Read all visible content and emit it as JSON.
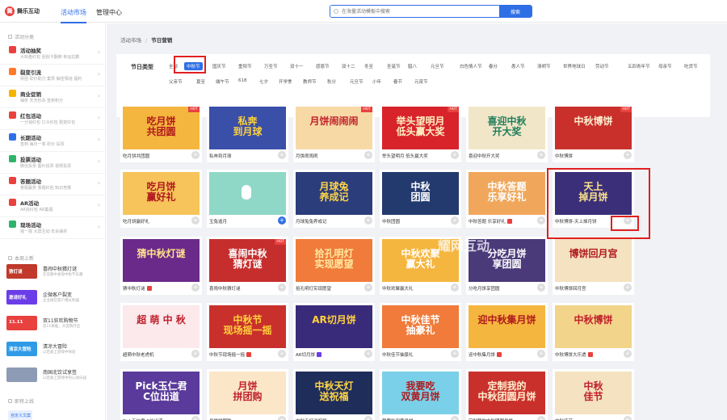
{
  "header": {
    "logo_text": "舞乐互动",
    "tabs": [
      {
        "label": "活动市场"
      },
      {
        "label": "管理中心"
      }
    ],
    "search_placeholder": "在海量活动模板中搜索",
    "search_button": "搜索"
  },
  "sidebar": {
    "section1_title": "活动分类",
    "categories": [
      {
        "title": "活动抽奖",
        "sub": "大转盘红包  刮刮卡翻牌  幸运拉霸",
        "color": "#e8413e"
      },
      {
        "title": "裂变引流",
        "sub": "拼团  砍价助力  集赞  解密猜谜  福利",
        "color": "#ff7a2b"
      },
      {
        "title": "商业促销",
        "sub": "抽奖  天天秒杀  签到积分",
        "color": "#f4b400"
      },
      {
        "title": "红包活动",
        "sub": "一分钱红包  口令红包  裂变红包",
        "color": "#e8413e"
      },
      {
        "title": "长期活动",
        "sub": "签到  每日一答  砍价  投票",
        "color": "#2f6fe6"
      },
      {
        "title": "投票活动",
        "sub": "微信投票  图片投票  视频投票",
        "color": "#2fb36a"
      },
      {
        "title": "答题活动",
        "sub": "答题赢奖  答题红包  知识竞赛",
        "color": "#e8413e"
      },
      {
        "title": "AR活动",
        "sub": "AR找红包  AR集福",
        "color": "#e8413e"
      },
      {
        "title": "现场活动",
        "sub": "摇一摇  大屏互动  年会抽奖",
        "color": "#2fb36a"
      }
    ],
    "section2_title": "本周上新",
    "news": [
      {
        "title": "喜闹中秋猜灯谜",
        "sub": "在答题中发现中秋节乐趣",
        "thumb": "猜灯谜",
        "color": "#c0392b"
      },
      {
        "title": "企微客户裂变",
        "sub": "企业微信客户增长利器",
        "thumb": "邀请好礼",
        "color": "#6a3de8"
      },
      {
        "title": "双11狂欢购物节",
        "sub": "双11来临，大促销开启",
        "thumb": "11.11",
        "color": "#e8413e"
      },
      {
        "title": "清凉大冒险",
        "sub": "以后爱上游戏中体验",
        "thumb": "清凉大冒险",
        "color": "#2f9be6"
      },
      {
        "title": "南国北饮试享签",
        "sub": "以后爱上游戏中的心动乐园",
        "thumb": "",
        "color": "#8e9bb5"
      }
    ],
    "section3_title": "即将上线",
    "upcoming": [
      {
        "title": "自定义文案"
      }
    ]
  },
  "main": {
    "breadcrumb": {
      "root": "活动市场",
      "current": "节日营销"
    },
    "filter_label": "节日类型",
    "chips_row1": [
      "全部",
      "中秋节",
      "国庆节",
      "重阳节",
      "万圣节",
      "双十一",
      "感恩节",
      "双十二",
      "冬至",
      "圣诞节",
      "腊八",
      "元旦节",
      "白色情人节",
      "春分",
      "愚人节",
      "清明节",
      "世界地球日",
      "劳动节",
      "五四青年节",
      "母亲节",
      "吃货节"
    ],
    "chips_row2": [
      "父亲节",
      "夏至",
      "端午节",
      "618",
      "七夕",
      "开学季",
      "教师节",
      "秋分",
      "元旦节",
      "小年",
      "春节",
      "元宵节"
    ],
    "active_chip": "中秋节",
    "watermark": "耀网互动",
    "cards": [
      {
        "name": "吃月饼共团圆",
        "title": "吃月饼\n共团圆",
        "hot": true,
        "bg": "#f5b63f",
        "fg": "#b0181d",
        "badge": ""
      },
      {
        "name": "私奔到月球",
        "title": "私奔\n到月球",
        "hot": false,
        "bg": "#3a4fa8",
        "fg": "#ffd23a",
        "badge": ""
      },
      {
        "name": "月饼闹闹闹",
        "title": "月饼闹闹闹",
        "hot": true,
        "bg": "#f7d9a6",
        "fg": "#c0202a",
        "badge": ""
      },
      {
        "name": "举头望明月 低头赢大奖",
        "title": "举头望明月\n低头赢大奖",
        "hot": true,
        "bg": "#d8232a",
        "fg": "#fff2c4",
        "badge": ""
      },
      {
        "name": "喜迎中秋开大奖",
        "title": "喜迎中秋\n开大奖",
        "hot": false,
        "bg": "#f2e6c8",
        "fg": "#1e7d5a",
        "badge": ""
      },
      {
        "name": "中秋博饼",
        "title": "中秋博饼",
        "hot": true,
        "bg": "#c9302c",
        "fg": "#fff0d0",
        "badge": ""
      },
      {
        "name": "吃月饼赢好礼",
        "title": "吃月饼\n赢好礼",
        "hot": false,
        "bg": "#f6c45a",
        "fg": "#b0181d",
        "badge": ""
      },
      {
        "name": "玉兔追月",
        "title": "",
        "hot": false,
        "bg": "#8fd8c8",
        "fg": "#ffffff",
        "badge": ""
      },
      {
        "name": "月球兔兔养成记",
        "title": "月球兔\n养成记",
        "hot": false,
        "bg": "#2b3d7a",
        "fg": "#ffd54a",
        "badge": ""
      },
      {
        "name": "中秋团圆",
        "title": "中秋\n团圆",
        "hot": false,
        "bg": "#233a6e",
        "fg": "#ffffff",
        "badge": ""
      },
      {
        "name": "中秋答题 乐享好礼",
        "title": "中秋答题\n乐享好礼",
        "hot": false,
        "bg": "#f0a75c",
        "fg": "#ffffff",
        "badge": "#e8413e"
      },
      {
        "name": "中秋博饼-天上掉月饼",
        "title": "天上\n掉月饼",
        "hot": false,
        "bg": "#3b2f7a",
        "fg": "#ffe58a",
        "badge": ""
      },
      {
        "name": "猜中秋灯谜",
        "title": "猜中秋灯谜",
        "hot": false,
        "bg": "#6a2a8a",
        "fg": "#ffe28a",
        "badge": "#e8413e"
      },
      {
        "name": "喜闹中秋猜灯谜",
        "title": "喜闹中秋\n猜灯谜",
        "hot": true,
        "bg": "#c62e2e",
        "fg": "#ffffff",
        "badge": ""
      },
      {
        "name": "拾孔明灯实现愿望",
        "title": "拾孔明灯\n实现愿望",
        "hot": false,
        "bg": "#f07b3a",
        "fg": "#ffe9a0",
        "badge": ""
      },
      {
        "name": "中秋欢聚赢大礼",
        "title": "中秋欢聚\n赢大礼",
        "hot": false,
        "bg": "#f5b63f",
        "fg": "#ffffff",
        "badge": ""
      },
      {
        "name": "分吃月饼享团圆",
        "title": "分吃月饼\n享团圆",
        "hot": false,
        "bg": "#4a3a7a",
        "fg": "#ffffff",
        "badge": ""
      },
      {
        "name": "中秋博饼回月宫",
        "title": "博饼回月宫",
        "hot": false,
        "bg": "#f4e2c0",
        "fg": "#b0181d",
        "badge": ""
      },
      {
        "name": "超萌中秋老虎机",
        "title": "超 萌 中 秋",
        "hot": false,
        "bg": "#fbe9ec",
        "fg": "#c0202a",
        "badge": ""
      },
      {
        "name": "中秋节现场摇一摇",
        "title": "中秋节\n现场摇一摇",
        "hot": false,
        "bg": "#c9302c",
        "fg": "#ffd23a",
        "badge": "#e8413e"
      },
      {
        "name": "AR切月饼",
        "title": "AR切月饼",
        "hot": false,
        "bg": "#3a2a7a",
        "fg": "#ffd23a",
        "badge": "#6a3de8"
      },
      {
        "name": "中秋佳节抽豪礼",
        "title": "中秋佳节\n抽豪礼",
        "hot": false,
        "bg": "#f07b3a",
        "fg": "#ffffff",
        "badge": ""
      },
      {
        "name": "迎中秋集月饼",
        "title": "迎中秋集月饼",
        "hot": false,
        "bg": "#f5b63f",
        "fg": "#b0181d",
        "badge": "#e8413e"
      },
      {
        "name": "中秋博饼大乐透",
        "title": "中秋博饼",
        "hot": false,
        "bg": "#f2d48a",
        "fg": "#c0202a",
        "badge": "#e8413e"
      },
      {
        "name": "Pick玉仁君 C位出道",
        "title": "Pick玉仁君\nC位出道",
        "hot": false,
        "bg": "#5a3a9a",
        "fg": "#ffffff",
        "badge": ""
      },
      {
        "name": "月饼拼团购",
        "title": "月饼\n拼团购",
        "hot": false,
        "bg": "#fbe6c8",
        "fg": "#c0202a",
        "badge": ""
      },
      {
        "name": "中秋天灯送祝福",
        "title": "中秋天灯\n送祝福",
        "hot": false,
        "bg": "#1f2d5a",
        "fg": "#ffd54a",
        "badge": ""
      },
      {
        "name": "我要吃双黄月饼",
        "title": "我要吃\n双黄月饼",
        "hot": false,
        "bg": "#7ad0e8",
        "fg": "#b0181d",
        "badge": ""
      },
      {
        "name": "定制我的中秋团圆月饼",
        "title": "定制我的\n中秋团圆月饼",
        "hot": false,
        "bg": "#c9302c",
        "fg": "#fff0d0",
        "badge": ""
      },
      {
        "name": "中秋佳节",
        "title": "中秋\n佳节",
        "hot": false,
        "bg": "#f4e2c0",
        "fg": "#c0202a",
        "badge": ""
      }
    ]
  }
}
